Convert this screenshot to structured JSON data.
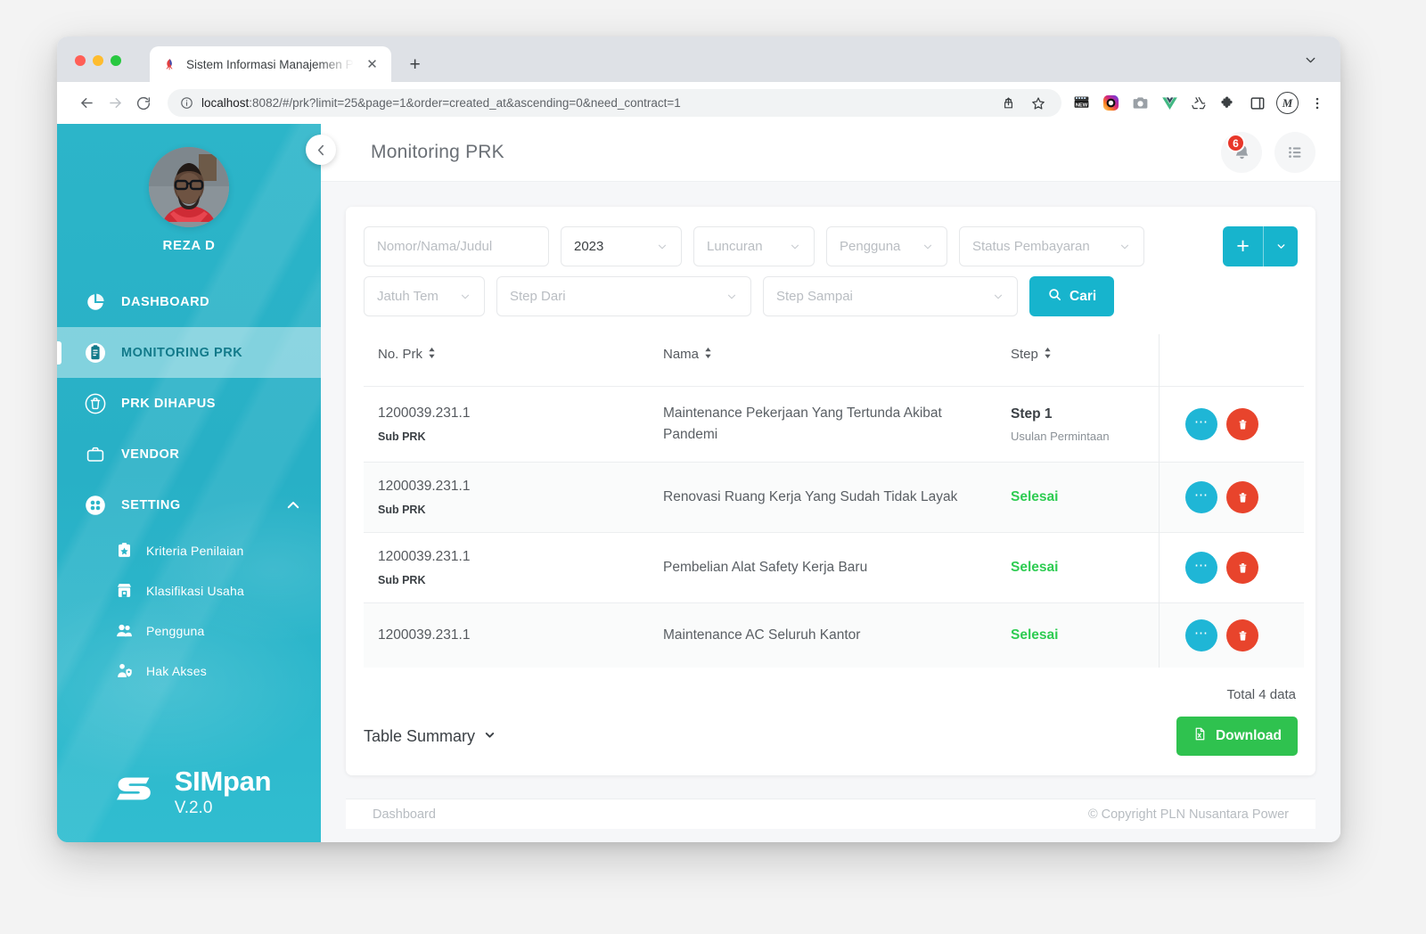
{
  "browser": {
    "tab": {
      "title": "Sistem Informasi Manajemen P",
      "favicon_name": "site-favicon",
      "close_label": "✕"
    },
    "new_tab_label": "+",
    "window_chevron_name": "chevron-down-icon",
    "nav": {
      "back_label": "←",
      "forward_label": "→",
      "reload_label": "⟳"
    },
    "omnibox": {
      "info_icon": "site-info-icon",
      "host": "localhost",
      "rest": ":8082/#/prk?limit=25&page=1&order=created_at&ascending=0&need_contract=1",
      "full_url": "localhost:8082/#/prk?limit=25&page=1&order=created_at&ascending=0&need_contract=1",
      "share_icon": "share-icon",
      "bookmark_icon": "star-icon"
    },
    "extensions": [
      {
        "name": "new-badge-extension-icon",
        "label": "NEW"
      },
      {
        "name": "instagram-extension-icon",
        "label": ""
      },
      {
        "name": "camera-extension-icon",
        "label": ""
      },
      {
        "name": "vue-devtools-extension-icon",
        "label": "V"
      },
      {
        "name": "recycle-extension-icon",
        "label": ""
      },
      {
        "name": "puzzle-extensions-icon",
        "label": ""
      },
      {
        "name": "side-panel-icon",
        "label": ""
      }
    ],
    "profile_avatar_letter": "M",
    "menu_icon": "kebab-menu-icon"
  },
  "sidebar": {
    "profile": {
      "name": "REZA D",
      "avatar_name": "user-avatar"
    },
    "items": [
      {
        "label": "DASHBOARD",
        "icon": "pie-chart-icon",
        "active": false
      },
      {
        "label": "MONITORING PRK",
        "icon": "clipboard-icon",
        "active": true
      },
      {
        "label": "PRK DIHAPUS",
        "icon": "trash-icon",
        "active": false
      },
      {
        "label": "VENDOR",
        "icon": "briefcase-icon",
        "active": false
      },
      {
        "label": "SETTING",
        "icon": "grid-dots-icon",
        "active": false,
        "expanded": true
      }
    ],
    "subitems": [
      {
        "label": "Kriteria Penilaian",
        "icon": "clipboard-star-icon"
      },
      {
        "label": "Klasifikasi Usaha",
        "icon": "store-icon"
      },
      {
        "label": "Pengguna",
        "icon": "users-icon"
      },
      {
        "label": "Hak Akses",
        "icon": "user-shield-icon"
      }
    ],
    "brand": {
      "name": "SIMpan",
      "version": "V.2.0",
      "logo_name": "simpan-logo"
    }
  },
  "topbar": {
    "title": "Monitoring PRK",
    "collapse_icon": "chevron-left-icon",
    "notifications": {
      "icon": "bell-icon",
      "count": "6"
    },
    "list_icon": "list-view-icon"
  },
  "filters": {
    "search_placeholder": "Nomor/Nama/Judul",
    "search_value": "",
    "year_value": "2023",
    "luncuran_placeholder": "Luncuran",
    "pengguna_placeholder": "Pengguna",
    "status_pembayaran_placeholder": "Status Pembayaran",
    "jatuh_tempo_placeholder": "Jatuh Tem",
    "step_dari_placeholder": "Step Dari",
    "step_sampai_placeholder": "Step Sampai",
    "search_button": "Cari",
    "search_icon": "search-icon",
    "add_button_label": "+",
    "add_dropdown_icon": "caret-down-icon"
  },
  "table": {
    "columns": [
      {
        "label": "No. Prk",
        "sortable": true
      },
      {
        "label": "Nama",
        "sortable": true
      },
      {
        "label": "Step",
        "sortable": true
      },
      {
        "label": "",
        "sortable": false
      }
    ],
    "rows": [
      {
        "no_prk": "1200039.231.1",
        "tag": "Sub PRK",
        "nama": "Maintenance Pekerjaan Yang Tertunda Akibat Pandemi",
        "step": "Step 1",
        "step_sub": "Usulan Permintaan",
        "step_done": false
      },
      {
        "no_prk": "1200039.231.1",
        "tag": "Sub PRK",
        "nama": "Renovasi Ruang Kerja Yang Sudah Tidak Layak",
        "step": "Selesai",
        "step_sub": "",
        "step_done": true
      },
      {
        "no_prk": "1200039.231.1",
        "tag": "Sub PRK",
        "nama": "Pembelian Alat Safety Kerja Baru",
        "step": "Selesai",
        "step_sub": "",
        "step_done": true
      },
      {
        "no_prk": "1200039.231.1",
        "tag": "",
        "nama": "Maintenance AC Seluruh Kantor",
        "step": "Selesai",
        "step_sub": "",
        "step_done": true
      }
    ],
    "row_actions": {
      "more_icon": "more-options-icon",
      "delete_icon": "delete-icon"
    },
    "total_text": "Total 4 data"
  },
  "footer_card": {
    "table_summary_label": "Table Summary",
    "table_summary_caret": "chevron-down-icon",
    "download_label": "Download",
    "download_icon": "file-excel-icon"
  },
  "page_footer": {
    "left": "Dashboard",
    "right": "© Copyright PLN Nusantara Power"
  },
  "colors": {
    "brand_teal": "#2cb5c9",
    "accent_cyan": "#17b4cd",
    "danger_red": "#e8442c",
    "success_green": "#2ecc52",
    "download_green": "#2fc24f",
    "badge_red": "#e8372a"
  }
}
